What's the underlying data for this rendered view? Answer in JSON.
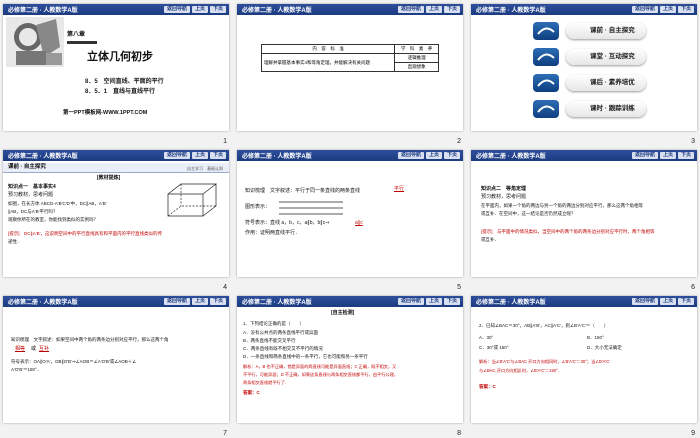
{
  "header": {
    "book": "必修第二册 · 人教数学A版",
    "nav_btn": "返回导航",
    "prev_btn": "上页",
    "next_btn": "下页"
  },
  "slides": [
    {
      "num": "1",
      "chapter": "第八章",
      "title": "立体几何初步",
      "sec1": "8．5　空间直线、平面的平行",
      "sec2": "8．5．1　直线与直线平行",
      "footer": "第一PPT模板网-WWW.1PPT.COM"
    },
    {
      "num": "2",
      "col1": "内　容　标　准",
      "col2": "学　科　素　养",
      "row": "理解并掌握基本事实4和等角定理，并能解决有关问题",
      "lit1": "逻辑推理",
      "lit2": "直观想象"
    },
    {
      "num": "3",
      "items": [
        "课前 · 自主探究",
        "课堂 · 互动探究",
        "课后 · 素养培优",
        "课时 · 跟踪训练"
      ]
    },
    {
      "num": "4",
      "head": "课前 · 自主探究",
      "tag": "自主学习　基础认知",
      "sub": "[教材提炼]",
      "l1": "知识点一　基本事实4",
      "l2": "预习教材，思考问题",
      "l3": "如图，在长方体 ABCD-A′B′C′D′中，DC∥AB，A′B′",
      "l4": "∥AB，DC与A′B′平行吗？",
      "l5": "观察你所在的教室，你能找到类似的实例吗？",
      "ans1": "[提示]　DC∥A′B′，这说明空间中的平行直线具有和平面内的平行直线类似的传",
      "ans2": "递性．"
    },
    {
      "num": "5",
      "l1": "知识梳理　文字叙述：平行于同一条直线的两条直线",
      "fill": "平行",
      "l2": "图形表示：",
      "l3": "符号表示：直线 a，b，c，a∥b，b∥c⇒",
      "fill2": "a∥c",
      "l4": "作用：证明两直线平行．"
    },
    {
      "num": "6",
      "l1": "知识点二　等角定理",
      "l2": "预习教材，思考问题",
      "l3": "在平面内，如果一个角的两边与另一个角的两边分别对应平行，那么这两个角相等",
      "l4": "或互补．在空间中，这一结论是否仍然成立呢？",
      "ans1": "[提示]　与平面中的情况类似，当空间中的两个角的两条边分别对应平行时，两个角相等",
      "ans2": "或互补．"
    },
    {
      "num": "7",
      "l1": "知识梳理　文字叙述：如果空间中两个角的两条边分别对应平行，那么这两个角",
      "fill": "相等",
      "l1b": "或",
      "fill2": "互补",
      "l2": "符号表示：OA∥O′A′，OB∥O′B′⇒∠AOB＝∠A′O′B′或∠AOB＋∠",
      "l3": "A′O′B′＝180°．"
    },
    {
      "num": "8",
      "head": "[自主检测]",
      "q": "1．下列结论正确的是（　　）",
      "a": "A．没有公共点的两条直线平行或异面",
      "bb": "B．两条直线不能交叉平行",
      "c": "C．两条直线有既不相交又不平行的情况",
      "d": "D．一条直线和两条直线中的一条平行，它也可能和另一条平行",
      "sol1": "解析：A，B 也不正确，错是异面的两直线可能是异面直线；C 正确，既不相交，又",
      "sol2": "不平行，可能异面；D 不正确，如果这条直线与两条相交直线都平行，由平行公理，",
      "sol3": "两条相交直线就平行了．",
      "ans": "答案：C"
    },
    {
      "num": "9",
      "q": "2．已知∠BAC＝30°，AB∥A′B′，AC∥A′C′，则∠B′A′C′＝（　　）",
      "a": "A．30°",
      "bb": "B．150°",
      "c": "C．30°或 150°",
      "d": "D．大小无法确定",
      "sol1": "解析：当∠B′A′C′与∠BAC 开口方向相同时，∠B′A′C′＝30°；当∠B′A′C′",
      "sol2": "与∠BAC 开口方向相反时，∠B′A′C′＝150°．",
      "ans": "答案：C"
    }
  ]
}
